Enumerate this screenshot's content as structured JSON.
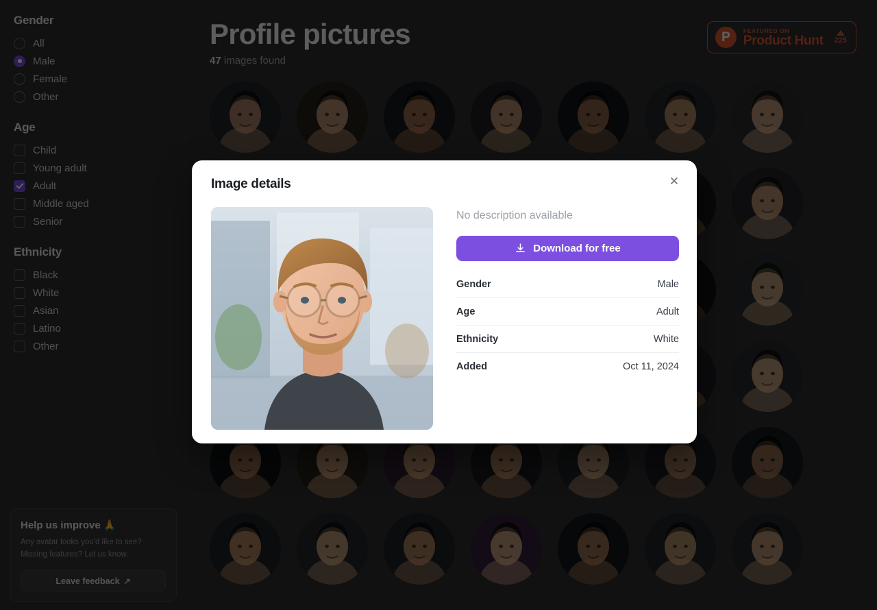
{
  "sidebar": {
    "groups": [
      {
        "title": "Gender",
        "control": "radio",
        "options": [
          {
            "label": "All",
            "selected": false
          },
          {
            "label": "Male",
            "selected": true
          },
          {
            "label": "Female",
            "selected": false
          },
          {
            "label": "Other",
            "selected": false
          }
        ]
      },
      {
        "title": "Age",
        "control": "checkbox",
        "options": [
          {
            "label": "Child",
            "selected": false
          },
          {
            "label": "Young adult",
            "selected": false
          },
          {
            "label": "Adult",
            "selected": true
          },
          {
            "label": "Middle aged",
            "selected": false
          },
          {
            "label": "Senior",
            "selected": false
          }
        ]
      },
      {
        "title": "Ethnicity",
        "control": "checkbox",
        "options": [
          {
            "label": "Black",
            "selected": false
          },
          {
            "label": "White",
            "selected": false
          },
          {
            "label": "Asian",
            "selected": false
          },
          {
            "label": "Latino",
            "selected": false
          },
          {
            "label": "Other",
            "selected": false
          }
        ]
      }
    ],
    "feedback": {
      "title": "Help us improve 🙏",
      "body": "Any avatar looks you'd like to see? Missing features? Let us know.",
      "button_label": "Leave feedback",
      "button_icon": "external-link-arrow-icon"
    }
  },
  "header": {
    "title": "Profile pictures",
    "count": "47",
    "count_suffix": "images found",
    "product_hunt": {
      "logo_letter": "P",
      "kicker": "FEATURED ON",
      "name": "Product Hunt",
      "upvotes": "225"
    }
  },
  "grid": {
    "columns": 7,
    "avatars": [
      {
        "id": "a1",
        "tone": "#b98b6d",
        "bg": "#1f2227",
        "alt": "man in cap"
      },
      {
        "id": "a2",
        "tone": "#c89b78",
        "bg": "#262119",
        "alt": "smiling man with beard"
      },
      {
        "id": "a3",
        "tone": "#a8724f",
        "bg": "#16181c",
        "alt": "man with dark hair"
      },
      {
        "id": "a4",
        "tone": "#c49a72",
        "bg": "#1d1f22",
        "alt": "smiling person"
      },
      {
        "id": "a5",
        "tone": "#9a6f50",
        "bg": "#121316",
        "alt": "man in hoodie"
      },
      {
        "id": "a6",
        "tone": "#c0916c",
        "bg": "#23252a",
        "alt": "man outdoors"
      },
      {
        "id": "a7",
        "tone": "#d3a783",
        "bg": "#2a2b2e",
        "alt": "couple smiling"
      },
      {
        "id": "a8",
        "tone": "#b07f5e",
        "bg": "#1a1c20",
        "alt": "portrait"
      },
      {
        "id": "a9",
        "tone": "#a77a57",
        "bg": "#191a1e",
        "alt": "portrait"
      },
      {
        "id": "a10",
        "tone": "#c59872",
        "bg": "#1e2024",
        "alt": "portrait"
      },
      {
        "id": "a11",
        "tone": "#b2845f",
        "bg": "#202227",
        "alt": "portrait"
      },
      {
        "id": "a12",
        "tone": "#caa07c",
        "bg": "#24262b",
        "alt": "portrait"
      },
      {
        "id": "a13",
        "tone": "#9d7151",
        "bg": "#15171a",
        "alt": "man with beard"
      },
      {
        "id": "a14",
        "tone": "#c9a07a",
        "bg": "#22242a",
        "alt": "man with beard"
      },
      {
        "id": "a15",
        "tone": "#b88a66",
        "bg": "#1c1e22",
        "alt": "portrait"
      },
      {
        "id": "a16",
        "tone": "#a9784f",
        "bg": "#181a1e",
        "alt": "portrait"
      },
      {
        "id": "a17",
        "tone": "#c08f69",
        "bg": "#212328",
        "alt": "portrait"
      },
      {
        "id": "a18",
        "tone": "#9c6d4c",
        "bg": "#141619",
        "alt": "portrait"
      },
      {
        "id": "a19",
        "tone": "#d0a47f",
        "bg": "#26282d",
        "alt": "man with glasses"
      },
      {
        "id": "a20",
        "tone": "#8a5c3d",
        "bg": "#101114",
        "alt": "portrait"
      },
      {
        "id": "a21",
        "tone": "#cfa77f",
        "bg": "#262a2f",
        "alt": "man with glasses"
      },
      {
        "id": "a22",
        "tone": "#b8875f",
        "bg": "#1b1d21",
        "alt": "portrait"
      },
      {
        "id": "a23",
        "tone": "#a97a55",
        "bg": "#1a1c1f",
        "alt": "portrait"
      },
      {
        "id": "a24",
        "tone": "#c39b76",
        "bg": "#202228",
        "alt": "portrait"
      },
      {
        "id": "a25",
        "tone": "#6a4630",
        "bg": "#121417",
        "alt": "smiling man yellow hat"
      },
      {
        "id": "a26",
        "tone": "#c89a71",
        "bg": "#1f2125",
        "alt": "portrait"
      },
      {
        "id": "a27",
        "tone": "#b18257",
        "bg": "#1d1f23",
        "alt": "portrait"
      },
      {
        "id": "a28",
        "tone": "#d2a884",
        "bg": "#27292e",
        "alt": "portrait"
      },
      {
        "id": "a29",
        "tone": "#a87a58",
        "bg": "#0f1013",
        "alt": "man dark background"
      },
      {
        "id": "a30",
        "tone": "#cba078",
        "bg": "#242118",
        "alt": "two people smiling"
      },
      {
        "id": "a31",
        "tone": "#c99a6e",
        "bg": "#2a1f2e",
        "alt": "person with purple light"
      },
      {
        "id": "a32",
        "tone": "#b78a63",
        "bg": "#181a1d",
        "alt": "smiling man"
      },
      {
        "id": "a33",
        "tone": "#c8a07c",
        "bg": "#1e2024",
        "alt": "two people glasses"
      },
      {
        "id": "a34",
        "tone": "#a97f5c",
        "bg": "#1a1c20",
        "alt": "man with beard"
      },
      {
        "id": "a35",
        "tone": "#9e7352",
        "bg": "#16181b",
        "alt": "man short hair"
      },
      {
        "id": "a36",
        "tone": "#c19069",
        "bg": "#1c2024",
        "alt": "person"
      },
      {
        "id": "a37",
        "tone": "#cda47f",
        "bg": "#23252a",
        "alt": "man shouting"
      },
      {
        "id": "a38",
        "tone": "#b88a65",
        "bg": "#1f2126",
        "alt": "two people glasses"
      },
      {
        "id": "a39",
        "tone": "#d3ab86",
        "bg": "#331f3a",
        "alt": "laughing person purple"
      },
      {
        "id": "a40",
        "tone": "#a97d59",
        "bg": "#141619",
        "alt": "man dark"
      },
      {
        "id": "a41",
        "tone": "#c29a74",
        "bg": "#202227",
        "alt": "man with beanie"
      },
      {
        "id": "a42",
        "tone": "#cba17b",
        "bg": "#242629",
        "alt": "man with beard"
      }
    ]
  },
  "modal": {
    "title": "Image details",
    "close_icon": "close-icon",
    "photo_alt": "Portrait of a young man with glasses and a beard in an office",
    "description": "No description available",
    "download": {
      "icon": "download-icon",
      "label": "Download for free"
    },
    "details": [
      {
        "key": "Gender",
        "value": "Male"
      },
      {
        "key": "Age",
        "value": "Adult"
      },
      {
        "key": "Ethnicity",
        "value": "White"
      },
      {
        "key": "Added",
        "value": "Oct 11, 2024"
      }
    ]
  },
  "colors": {
    "accent_purple": "#7c4fe0",
    "product_hunt_orange": "#db5831",
    "page_background": "#2e2e2e",
    "sidebar_background": "#2f2f2f",
    "modal_background": "#ffffff"
  }
}
